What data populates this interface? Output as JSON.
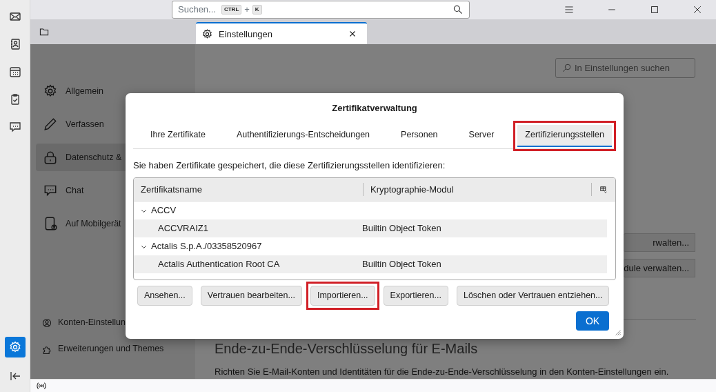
{
  "toolbar": {
    "search": {
      "placeholder": "Suchen...",
      "keys": [
        "CTRL",
        "+",
        "K"
      ]
    }
  },
  "rail": [
    {
      "kind": "mail",
      "selected": false
    },
    {
      "kind": "contacts",
      "selected": false
    },
    {
      "kind": "calendar",
      "selected": false
    },
    {
      "kind": "tasks",
      "selected": false
    },
    {
      "kind": "chat",
      "selected": false
    }
  ],
  "rail_bottom": [
    {
      "kind": "settings",
      "selected": true
    },
    {
      "kind": "collapse",
      "selected": false
    }
  ],
  "tabs": [
    {
      "kind": "folder",
      "selected": false
    },
    {
      "kind": "settings",
      "label": "Einstellungen",
      "selected": true
    }
  ],
  "settings": {
    "search": {
      "placeholder": "In Einstellungen suchen"
    },
    "nav": [
      {
        "kind": "general",
        "label": "Allgemein",
        "selected": false
      },
      {
        "kind": "compose",
        "label": "Verfassen",
        "selected": false
      },
      {
        "kind": "privacy",
        "label": "Datenschutz &",
        "selected": true
      },
      {
        "kind": "chat",
        "label": "Chat",
        "selected": false
      },
      {
        "kind": "mobile",
        "label": "Auf Mobilgerät",
        "selected": false
      }
    ],
    "nav_bottom": [
      {
        "kind": "account",
        "label": "Konten-Einstellun"
      },
      {
        "kind": "addons",
        "label": "Erweiterungen und Themes"
      }
    ],
    "buttons": [
      "rwalten...",
      "dule verwalten..."
    ],
    "heading": "Ende-zu-Ende-Verschlüsselung für E-Mails",
    "paragraph": "Richten Sie E-Mail-Konten und Identitäten für die Ende-zu-Ende-Verschlüsselung in den Konten-Einstellungen ein."
  },
  "dialog": {
    "title": "Zertifikatverwaltung",
    "tabs": [
      {
        "label": "Ihre Zertifikate",
        "selected": false,
        "highlighted": false
      },
      {
        "label": "Authentifizierungs-Entscheidungen",
        "selected": false,
        "highlighted": false
      },
      {
        "label": "Personen",
        "selected": false,
        "highlighted": false
      },
      {
        "label": "Server",
        "selected": false,
        "highlighted": false
      },
      {
        "label": "Zertifizierungsstellen",
        "selected": true,
        "highlighted": true
      }
    ],
    "description": "Sie haben Zertifikate gespeichert, die diese Zertifizierungsstellen identifizieren:",
    "columns": [
      "Zertifikatsname",
      "Kryptographie-Modul"
    ],
    "groups": [
      {
        "name": "ACCV",
        "expanded": true,
        "children": [
          {
            "name": "ACCVRAIZ1",
            "module": "Builtin Object Token"
          }
        ]
      },
      {
        "name": "Actalis S.p.A./03358520967",
        "expanded": true,
        "children": [
          {
            "name": "Actalis Authentication Root CA",
            "module": "Builtin Object Token"
          }
        ]
      }
    ],
    "buttons": [
      {
        "label": "Ansehen...",
        "highlighted": false
      },
      {
        "label": "Vertrauen bearbeiten...",
        "highlighted": false
      },
      {
        "label": "Importieren...",
        "highlighted": true
      },
      {
        "label": "Exportieren...",
        "highlighted": false
      },
      {
        "label": "Löschen oder Vertrauen entziehen...",
        "highlighted": false
      }
    ],
    "ok": "OK"
  }
}
